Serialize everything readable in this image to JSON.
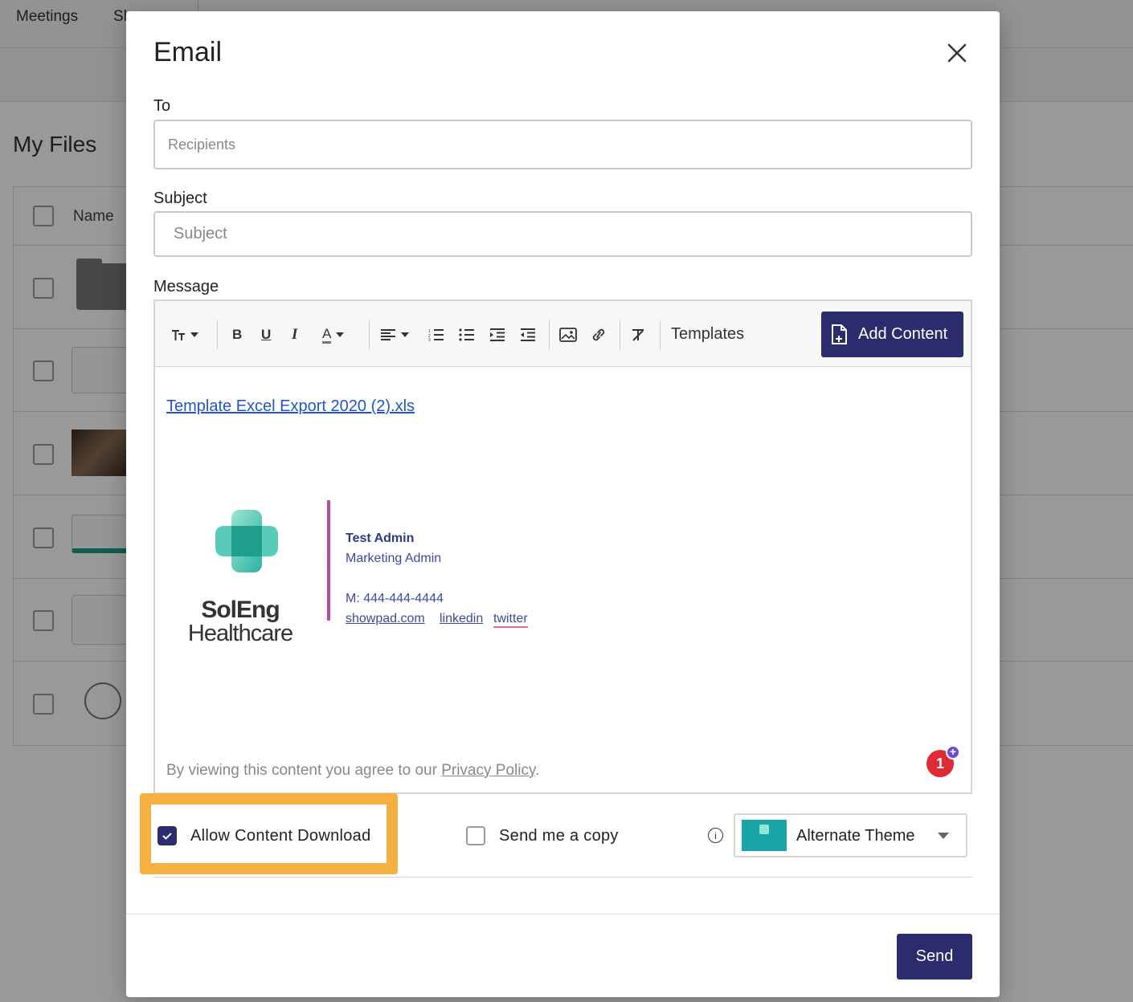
{
  "background": {
    "nav": [
      "Meetings",
      "Sh"
    ],
    "page_title": "My Files",
    "table_header_name": "Name"
  },
  "modal": {
    "title": "Email",
    "to_label": "To",
    "to_placeholder": "Recipients",
    "subject_label": "Subject",
    "subject_placeholder": "Subject",
    "message_label": "Message",
    "toolbar": {
      "templates_label": "Templates",
      "add_content_label": "Add Content"
    },
    "editor": {
      "attachment_link": "Template Excel Export 2020 (2).xls",
      "logo_line1": "SolEng",
      "logo_line2": "Healthcare",
      "signature": {
        "name": "Test Admin",
        "role": "Marketing Admin",
        "phone": "M: 444-444-4444",
        "links": [
          "showpad.com",
          "linkedin",
          "twitter"
        ]
      },
      "privacy_prefix": "By viewing this content you agree to our ",
      "privacy_link": "Privacy Policy",
      "privacy_suffix": ".",
      "badge_count": "1"
    },
    "options": {
      "allow_download_label": "Allow Content Download",
      "allow_download_checked": true,
      "send_copy_label": "Send me a copy",
      "send_copy_checked": false,
      "info_icon": "info-icon",
      "theme_selected": "Alternate Theme"
    },
    "send_label": "Send"
  },
  "colors": {
    "primary": "#2a2c6e",
    "highlight": "#f5b041",
    "signature_bar": "#c0489a",
    "badge": "#e02a36"
  }
}
